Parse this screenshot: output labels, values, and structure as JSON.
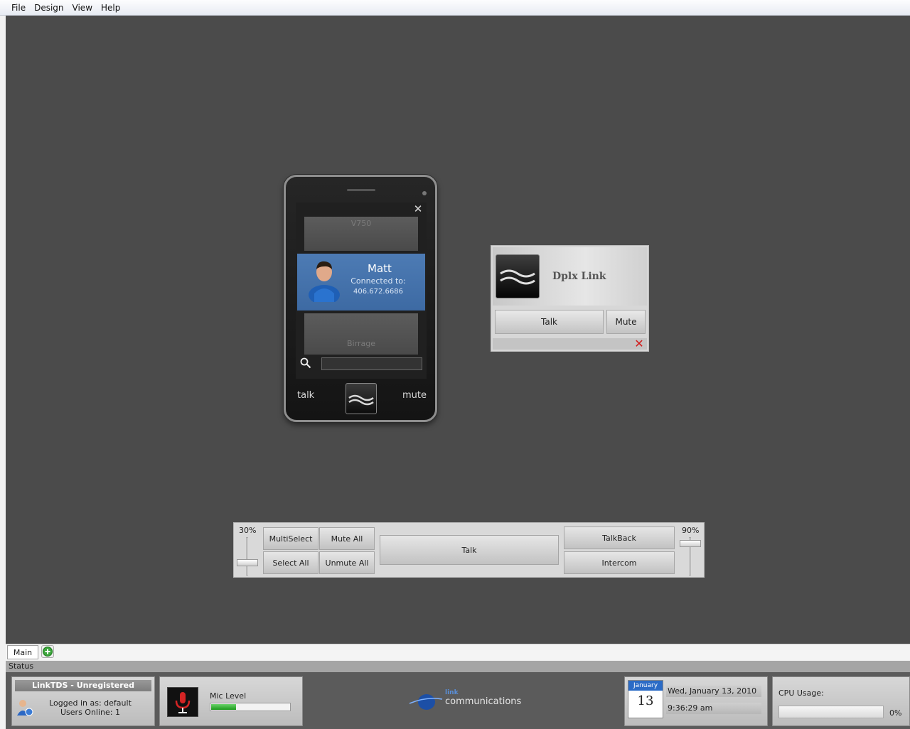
{
  "menu": [
    "File",
    "Design",
    "View",
    "Help"
  ],
  "phone": {
    "top_slot": "V750",
    "contact_name": "Matt",
    "connected_label": "Connected to:",
    "connected_number": "406.672.6686",
    "bottom_slot": "Birrage",
    "search_value": "",
    "talk_label": "talk",
    "mute_label": "mute",
    "close_icon": "close-icon"
  },
  "dplx": {
    "title": "Dplx Link",
    "talk_label": "Talk",
    "mute_label": "Mute",
    "close_color": "#d21a1a"
  },
  "controls": {
    "left_slider_label": "30%",
    "left_slider_level": 0.3,
    "right_slider_label": "90%",
    "right_slider_level": 0.9,
    "multiselect": "MultiSelect",
    "mute_all": "Mute All",
    "select_all": "Select All",
    "unmute_all": "Unmute All",
    "talk": "Talk",
    "talkback": "TalkBack",
    "intercom": "Intercom"
  },
  "tabs": {
    "main": "Main"
  },
  "status": {
    "header": "Status",
    "app_title": "LinkTDS - Unregistered",
    "logged_in": "Logged in as: default",
    "users_online": "Users Online: 1",
    "mic_label": "Mic Level",
    "mic_level": 0.32,
    "brand_top": "link",
    "brand_bottom": "communications",
    "cal_month": "January",
    "cal_day": "13",
    "date_text": "Wed, January 13, 2010",
    "time_text": "9:36:29 am",
    "cpu_label": "CPU Usage:",
    "cpu_value": "0%"
  },
  "colors": {
    "canvas": "#4b4b4b",
    "active_contact": "#4672ac",
    "accent_blue": "#2b6bc6"
  }
}
